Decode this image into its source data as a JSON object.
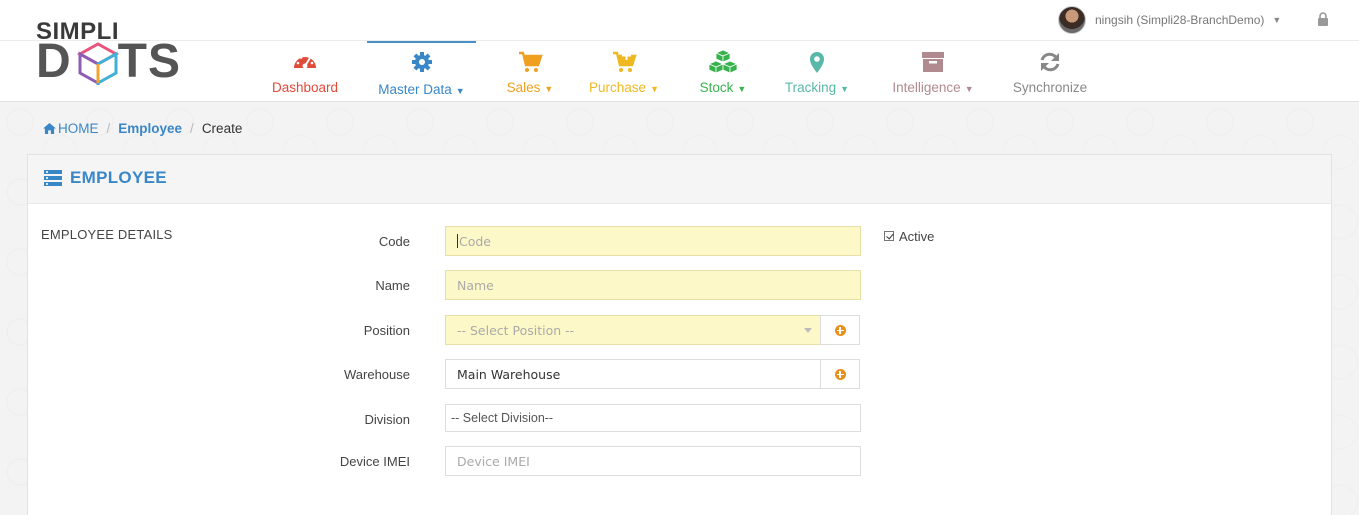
{
  "brand": {
    "line1": "SIMPLI",
    "line2": "DOTS",
    "line2_prefix": "D",
    "line2_suffix": "TS"
  },
  "user": {
    "name": "ningsih (Simpli28-BranchDemo)"
  },
  "nav": [
    {
      "label": "Dashboard",
      "icon": "speedometer-icon",
      "color": "#e04b3a",
      "dropdown": false
    },
    {
      "label": "Master Data",
      "icon": "gear-icon",
      "color": "#3a87c8",
      "dropdown": true,
      "active": true
    },
    {
      "label": "Sales",
      "icon": "cart-icon",
      "color": "#f0a020",
      "dropdown": true
    },
    {
      "label": "Purchase",
      "icon": "cart-plus-icon",
      "color": "#f0b820",
      "dropdown": true
    },
    {
      "label": "Stock",
      "icon": "cubes-icon",
      "color": "#37b24d",
      "dropdown": true
    },
    {
      "label": "Tracking",
      "icon": "map-marker-icon",
      "color": "#5ab8a8",
      "dropdown": true
    },
    {
      "label": "Intelligence",
      "icon": "archive-icon",
      "color": "#b08a8e",
      "dropdown": true
    },
    {
      "label": "Synchronize",
      "icon": "refresh-icon",
      "color": "#888888",
      "dropdown": false
    }
  ],
  "breadcrumb": {
    "home": "HOME",
    "section": "Employee",
    "current": "Create"
  },
  "panel": {
    "title": "EMPLOYEE",
    "section": "EMPLOYEE DETAILS"
  },
  "form": {
    "code": {
      "label": "Code",
      "placeholder": "Code",
      "value": ""
    },
    "name": {
      "label": "Name",
      "placeholder": "Name",
      "value": ""
    },
    "position": {
      "label": "Position",
      "value": "-- Select Position --"
    },
    "warehouse": {
      "label": "Warehouse",
      "value": "Main Warehouse"
    },
    "division": {
      "label": "Division",
      "value": "-- Select Division--"
    },
    "device_imei": {
      "label": "Device IMEI",
      "placeholder": "Device IMEI",
      "value": ""
    },
    "active": {
      "label": "Active",
      "checked": true
    }
  },
  "colors": {
    "accent": "#3a87c8",
    "required_bg": "#fdf8c8",
    "add_button": "#e8901e"
  }
}
